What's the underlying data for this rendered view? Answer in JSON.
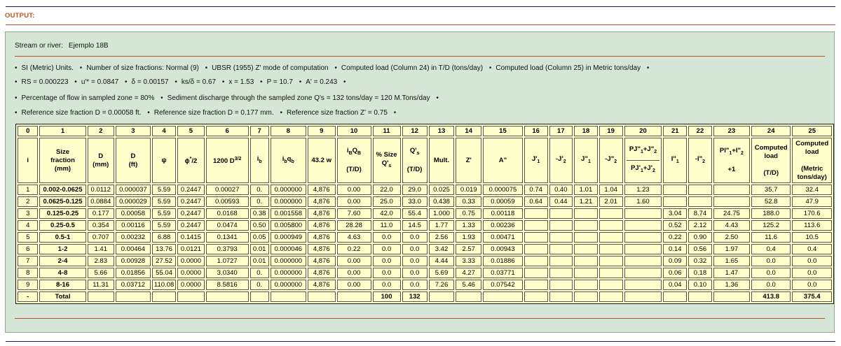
{
  "output_label": "OUTPUT:",
  "stream": {
    "label": "Stream or river:",
    "value": "Ejemplo 18B"
  },
  "info": {
    "line1": [
      "SI (Metric) Units.",
      "Number of size fractions:  Normal (9)",
      "UBSR (1955) Z' mode of computation",
      "Computed load (Column 24) in T/D (tons/day)",
      "Computed load (Column 25) in Metric tons/day"
    ],
    "line2": [
      "RS = 0.000223",
      "u'* = 0.0847",
      "δ = 0.00157",
      "ks/δ = 0.67",
      "x = 1.53",
      "P = 10.7",
      "A' = 0.243"
    ],
    "line3": [
      "Percentage of flow in sampled zone = 80%",
      "Sediment discharge through the sampled zone Q's = 132 tons/day = 120 M.Tons/day"
    ],
    "line4": [
      "Reference size fraction D = 0.00058 ft.",
      "Reference size fraction D = 0.177 mm.",
      "Reference size fraction Z' = 0.75"
    ]
  },
  "table": {
    "col_numbers": [
      "0",
      "1",
      "2",
      "3",
      "4",
      "5",
      "6",
      "7",
      "8",
      "9",
      "10",
      "11",
      "12",
      "13",
      "14",
      "15",
      "16",
      "17",
      "18",
      "19",
      "20",
      "21",
      "22",
      "23",
      "24",
      "25"
    ],
    "headers": [
      "i",
      "Size fraction (mm)",
      "D (mm)",
      "D (ft)",
      "ψ",
      "ɸ*/2",
      "1200 D3/2",
      "ib",
      "ibqb",
      "43.2 w",
      "iBQB (T/D)",
      "% Size Q's",
      "Q's (T/D)",
      "Mult.",
      "Z'",
      "A\"",
      "J'1",
      "-J'2",
      "J\"1",
      "-J\"2",
      "PJ\"1+J\"2 / PJ'1+J'2",
      "I\"1",
      "-I\"2",
      "PI\"1+I\"2 +1",
      "Computed load (T/D)",
      "Computed load (Metric tons/day)"
    ],
    "rows": [
      [
        "1",
        "0.002-0.0625",
        "0.0112",
        "0.000037",
        "5.59",
        "0.2447",
        "0.00027",
        "0.",
        "0.000000",
        "4,876",
        "0.00",
        "22.0",
        "29.0",
        "0.025",
        "0.019",
        "0.000075",
        "0.74",
        "0.40",
        "1.01",
        "1.04",
        "1.23",
        "",
        "",
        "",
        "35.7",
        "32.4"
      ],
      [
        "2",
        "0.0625-0.125",
        "0.0884",
        "0.000029",
        "5.59",
        "0.2447",
        "0.00593",
        "0.",
        "0.000000",
        "4,876",
        "0.00",
        "25.0",
        "33.0",
        "0.438",
        "0.33",
        "0.00059",
        "0.64",
        "0.44",
        "1.21",
        "2.01",
        "1.60",
        "",
        "",
        "",
        "52.8",
        "47.9"
      ],
      [
        "3",
        "0.125-0.25",
        "0.177",
        "0.00058",
        "5.59",
        "0.2447",
        "0.0168",
        "0.38",
        "0.001558",
        "4,876",
        "7.60",
        "42.0",
        "55.4",
        "1.000",
        "0.75",
        "0.00118",
        "",
        "",
        "",
        "",
        "",
        "3.04",
        "8.74",
        "24.75",
        "188.0",
        "170.6"
      ],
      [
        "4",
        "0.25-0.5",
        "0.354",
        "0.00116",
        "5.59",
        "0.2447",
        "0.0474",
        "0.50",
        "0.005800",
        "4,876",
        "28.28",
        "11.0",
        "14.5",
        "1.77",
        "1.33",
        "0.00236",
        "",
        "",
        "",
        "",
        "",
        "0.52",
        "2.12",
        "4.43",
        "125.2",
        "113.6"
      ],
      [
        "5",
        "0.5-1",
        "0.707",
        "0.00232",
        "6.88",
        "0.1415",
        "0.1341",
        "0.05",
        "0.000949",
        "4,876",
        "4.63",
        "0.0",
        "0.0",
        "2.56",
        "1.93",
        "0.00471",
        "",
        "",
        "",
        "",
        "",
        "0.22",
        "0.90",
        "2.50",
        "11.6",
        "10.5"
      ],
      [
        "6",
        "1-2",
        "1.41",
        "0.00464",
        "13.76",
        "0.0121",
        "0.3793",
        "0.01",
        "0.000046",
        "4,876",
        "0.22",
        "0.0",
        "0.0",
        "3.42",
        "2.57",
        "0.00943",
        "",
        "",
        "",
        "",
        "",
        "0.14",
        "0.56",
        "1.97",
        "0.4",
        "0.4"
      ],
      [
        "7",
        "2-4",
        "2.83",
        "0.00928",
        "27.52",
        "0.0000",
        "1.0727",
        "0.01",
        "0.000000",
        "4,876",
        "0.00",
        "0.0",
        "0.0",
        "4.44",
        "3.33",
        "0.01886",
        "",
        "",
        "",
        "",
        "",
        "0.09",
        "0.32",
        "1.65",
        "0.0",
        "0.0"
      ],
      [
        "8",
        "4-8",
        "5.66",
        "0.01856",
        "55.04",
        "0.0000",
        "3.0340",
        "0.",
        "0.000000",
        "4,876",
        "0.00",
        "0.0",
        "0.0",
        "5.69",
        "4.27",
        "0.03771",
        "",
        "",
        "",
        "",
        "",
        "0.06",
        "0.18",
        "1.47",
        "0.0",
        "0.0"
      ],
      [
        "9",
        "8-16",
        "11.31",
        "0.03712",
        "110.08",
        "0.0000",
        "8.5816",
        "0.",
        "0.000000",
        "4,876",
        "0.00",
        "0.0",
        "0.0",
        "7.26",
        "5.46",
        "0.07542",
        "",
        "",
        "",
        "",
        "",
        "0.04",
        "0.10",
        "1.36",
        "0.0",
        "0.0"
      ]
    ],
    "total": [
      "-",
      "Total",
      "",
      "",
      "",
      "",
      "",
      "",
      "",
      "",
      "",
      "100",
      "132",
      "",
      "",
      "",
      "",
      "",
      "",
      "",
      "",
      "",
      "",
      "",
      "413.8",
      "375.4"
    ]
  }
}
